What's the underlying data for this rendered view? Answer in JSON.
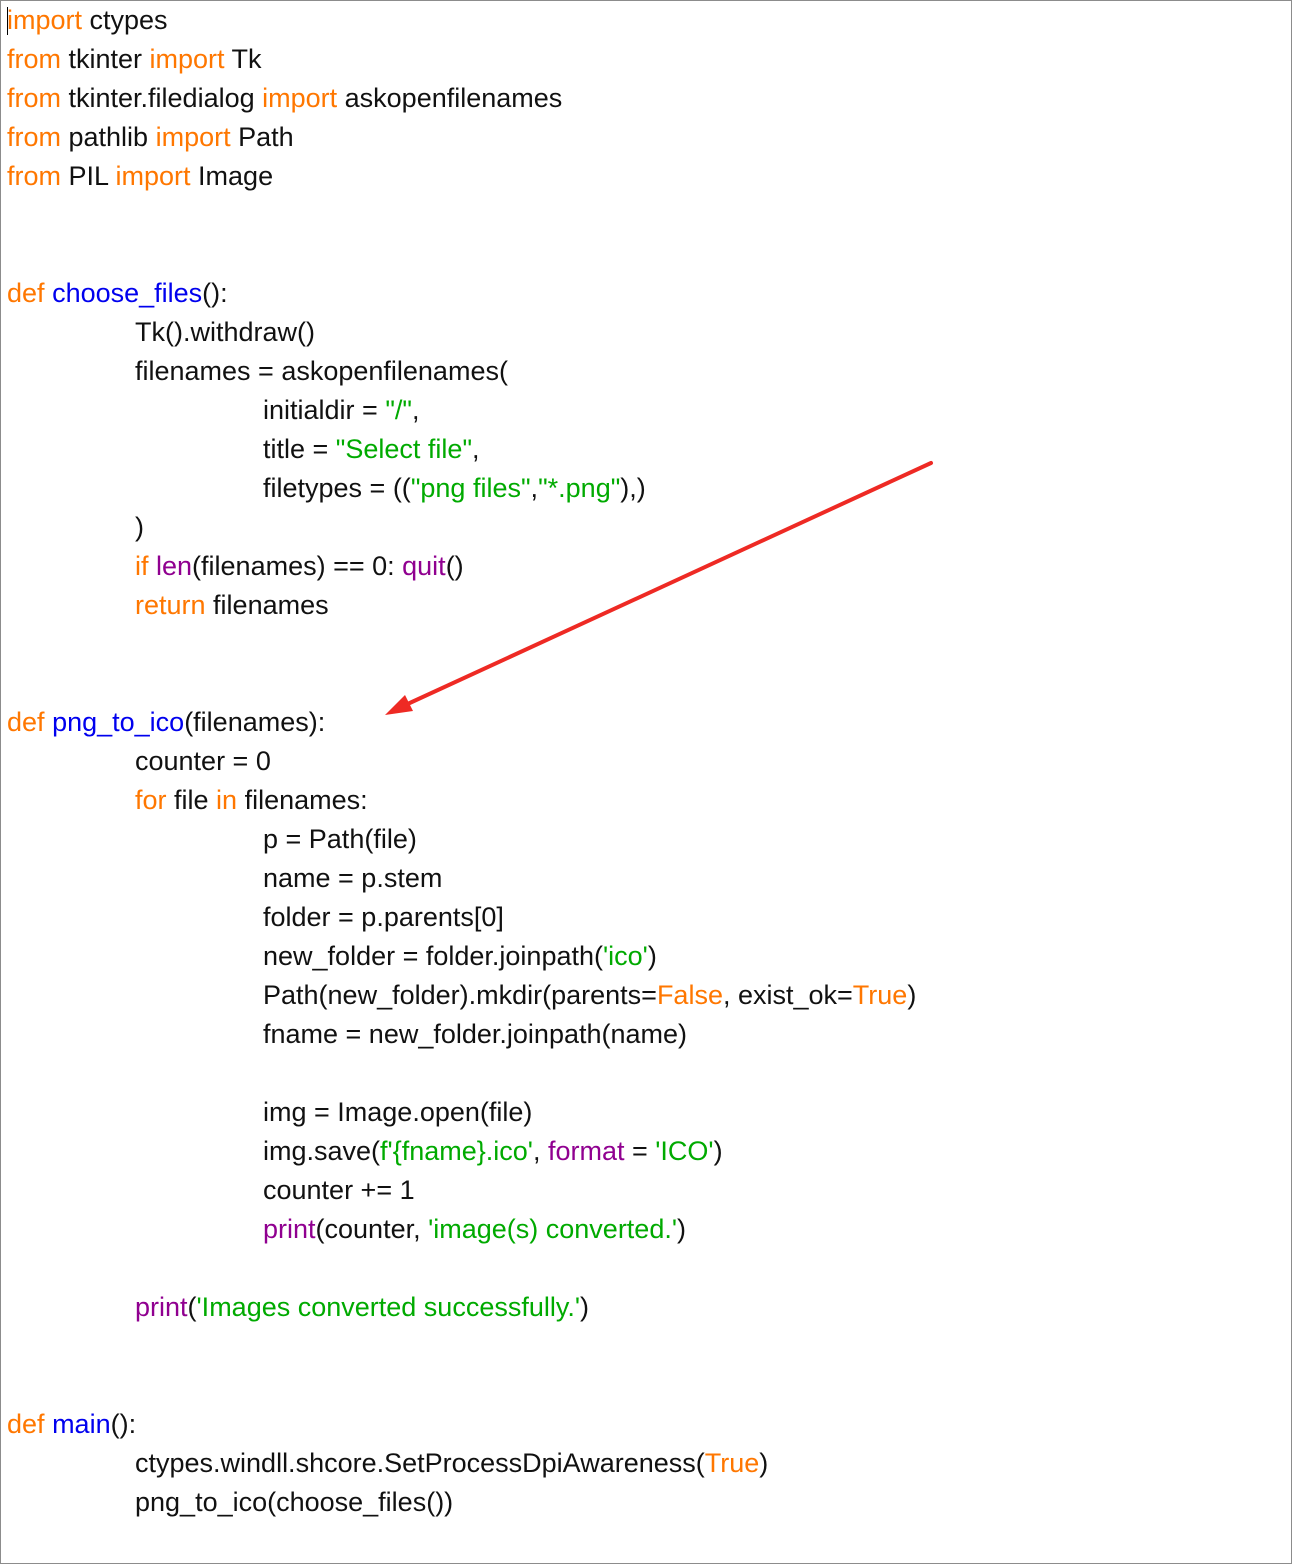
{
  "colors": {
    "keyword": "#ff7700",
    "definition": "#0000ee",
    "builtin": "#900090",
    "string": "#00aa00",
    "text": "#111111",
    "annotation_arrow": "#ee2a24"
  },
  "lines": [
    {
      "indent": 0,
      "tokens": [
        [
          "kw",
          "import"
        ],
        [
          "t",
          " ctypes"
        ]
      ]
    },
    {
      "indent": 0,
      "tokens": [
        [
          "kw",
          "from"
        ],
        [
          "t",
          " tkinter "
        ],
        [
          "kw",
          "import"
        ],
        [
          "t",
          " Tk"
        ]
      ]
    },
    {
      "indent": 0,
      "tokens": [
        [
          "kw",
          "from"
        ],
        [
          "t",
          " tkinter.filedialog "
        ],
        [
          "kw",
          "import"
        ],
        [
          "t",
          " askopenfilenames"
        ]
      ]
    },
    {
      "indent": 0,
      "tokens": [
        [
          "kw",
          "from"
        ],
        [
          "t",
          " pathlib "
        ],
        [
          "kw",
          "import"
        ],
        [
          "t",
          " Path"
        ]
      ]
    },
    {
      "indent": 0,
      "tokens": [
        [
          "kw",
          "from"
        ],
        [
          "t",
          " PIL "
        ],
        [
          "kw",
          "import"
        ],
        [
          "t",
          " Image"
        ]
      ]
    },
    {
      "indent": 0,
      "tokens": []
    },
    {
      "indent": 0,
      "tokens": []
    },
    {
      "indent": 0,
      "tokens": [
        [
          "kw",
          "def"
        ],
        [
          "t",
          " "
        ],
        [
          "fn",
          "choose_files"
        ],
        [
          "t",
          "():"
        ]
      ]
    },
    {
      "indent": 1,
      "tokens": [
        [
          "t",
          "Tk().withdraw()"
        ]
      ]
    },
    {
      "indent": 1,
      "tokens": [
        [
          "t",
          "filenames = askopenfilenames("
        ]
      ]
    },
    {
      "indent": 2,
      "tokens": [
        [
          "t",
          "initialdir = "
        ],
        [
          "str",
          "\"/\""
        ],
        [
          "t",
          ","
        ]
      ]
    },
    {
      "indent": 2,
      "tokens": [
        [
          "t",
          "title = "
        ],
        [
          "str",
          "\"Select file\""
        ],
        [
          "t",
          ","
        ]
      ]
    },
    {
      "indent": 2,
      "tokens": [
        [
          "t",
          "filetypes = (("
        ],
        [
          "str",
          "\"png files\""
        ],
        [
          "t",
          ","
        ],
        [
          "str",
          "\"*.png\""
        ],
        [
          "t",
          "),)"
        ]
      ]
    },
    {
      "indent": 1,
      "tokens": [
        [
          "t",
          ")"
        ]
      ]
    },
    {
      "indent": 1,
      "tokens": [
        [
          "kw",
          "if"
        ],
        [
          "t",
          " "
        ],
        [
          "bi",
          "len"
        ],
        [
          "t",
          "(filenames) == 0: "
        ],
        [
          "bi",
          "quit"
        ],
        [
          "t",
          "()"
        ]
      ]
    },
    {
      "indent": 1,
      "tokens": [
        [
          "kw",
          "return"
        ],
        [
          "t",
          " filenames"
        ]
      ]
    },
    {
      "indent": 0,
      "tokens": []
    },
    {
      "indent": 0,
      "tokens": []
    },
    {
      "indent": 0,
      "tokens": [
        [
          "kw",
          "def"
        ],
        [
          "t",
          " "
        ],
        [
          "fn",
          "png_to_ico"
        ],
        [
          "t",
          "(filenames):"
        ]
      ]
    },
    {
      "indent": 1,
      "tokens": [
        [
          "t",
          "counter = 0"
        ]
      ]
    },
    {
      "indent": 1,
      "tokens": [
        [
          "kw",
          "for"
        ],
        [
          "t",
          " file "
        ],
        [
          "kw",
          "in"
        ],
        [
          "t",
          " filenames:"
        ]
      ]
    },
    {
      "indent": 2,
      "tokens": [
        [
          "t",
          "p = Path(file)"
        ]
      ]
    },
    {
      "indent": 2,
      "tokens": [
        [
          "t",
          "name = p.stem"
        ]
      ]
    },
    {
      "indent": 2,
      "tokens": [
        [
          "t",
          "folder = p.parents[0]"
        ]
      ]
    },
    {
      "indent": 2,
      "tokens": [
        [
          "t",
          "new_folder = folder.joinpath("
        ],
        [
          "str",
          "'ico'"
        ],
        [
          "t",
          ")"
        ]
      ]
    },
    {
      "indent": 2,
      "tokens": [
        [
          "t",
          "Path(new_folder).mkdir(parents="
        ],
        [
          "kw",
          "False"
        ],
        [
          "t",
          ", exist_ok="
        ],
        [
          "kw",
          "True"
        ],
        [
          "t",
          ")"
        ]
      ]
    },
    {
      "indent": 2,
      "tokens": [
        [
          "t",
          "fname = new_folder.joinpath(name)"
        ]
      ]
    },
    {
      "indent": 0,
      "tokens": []
    },
    {
      "indent": 2,
      "tokens": [
        [
          "t",
          "img = Image.open(file)"
        ]
      ]
    },
    {
      "indent": 2,
      "tokens": [
        [
          "t",
          "img.save("
        ],
        [
          "str",
          "f'{fname}.ico'"
        ],
        [
          "t",
          ", "
        ],
        [
          "bi",
          "format"
        ],
        [
          "t",
          " = "
        ],
        [
          "str",
          "'ICO'"
        ],
        [
          "t",
          ")"
        ]
      ]
    },
    {
      "indent": 2,
      "tokens": [
        [
          "t",
          "counter += 1"
        ]
      ]
    },
    {
      "indent": 2,
      "tokens": [
        [
          "bi",
          "print"
        ],
        [
          "t",
          "(counter, "
        ],
        [
          "str",
          "'image(s) converted.'"
        ],
        [
          "t",
          ")"
        ]
      ]
    },
    {
      "indent": 0,
      "tokens": []
    },
    {
      "indent": 1,
      "tokens": [
        [
          "bi",
          "print"
        ],
        [
          "t",
          "("
        ],
        [
          "str",
          "'Images converted successfully.'"
        ],
        [
          "t",
          ")"
        ]
      ]
    },
    {
      "indent": 0,
      "tokens": []
    },
    {
      "indent": 0,
      "tokens": []
    },
    {
      "indent": 0,
      "tokens": [
        [
          "kw",
          "def"
        ],
        [
          "t",
          " "
        ],
        [
          "fn",
          "main"
        ],
        [
          "t",
          "():"
        ]
      ]
    },
    {
      "indent": 1,
      "tokens": [
        [
          "t",
          "ctypes.windll.shcore.SetProcessDpiAwareness("
        ],
        [
          "kw",
          "True"
        ],
        [
          "t",
          ")"
        ]
      ]
    },
    {
      "indent": 1,
      "tokens": [
        [
          "t",
          "png_to_ico(choose_files())"
        ]
      ]
    }
  ]
}
